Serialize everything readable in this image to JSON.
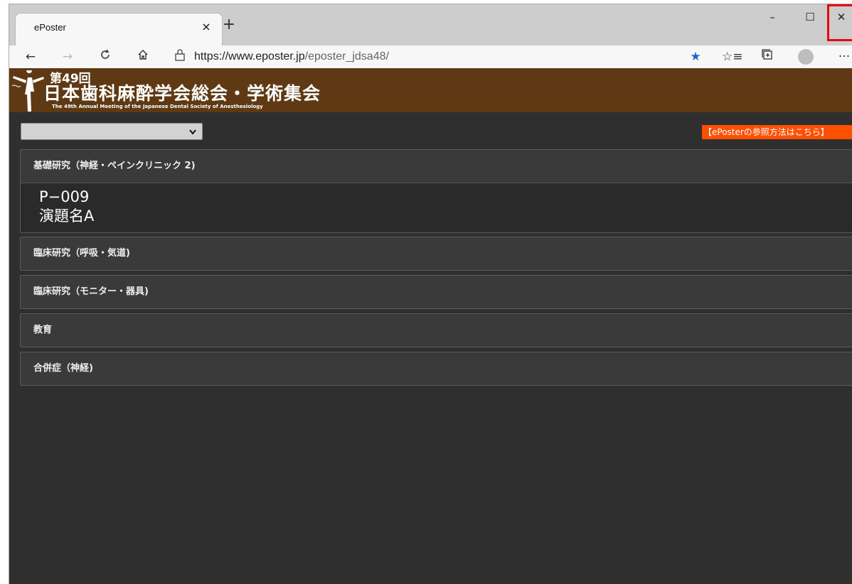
{
  "browser": {
    "tab_title": "ePoster",
    "tab_close_glyph": "×",
    "new_tab_glyph": "+",
    "url_host": "https://www.eposter.jp",
    "url_path": "/eposter_jdsa48/",
    "window_controls": {
      "minimize": "–",
      "maximize": "☐",
      "close": "✕"
    }
  },
  "banner": {
    "edition": "第49回",
    "title": "日本歯科麻酔学会総会・学術集会",
    "english": "The 49th Annual Meeting of the Japanese Dental Society of Anesthesiology"
  },
  "toolbar": {
    "select_value": "",
    "help_link": "【ePosterの参照方法はこちら】"
  },
  "sections": [
    {
      "title": "基礎研究（神経・ペインクリニック 2)",
      "expanded": true,
      "poster_number": "P−009",
      "poster_title": "演題名A"
    },
    {
      "title": "臨床研究（呼吸・気道)"
    },
    {
      "title": "臨床研究（モニター・器具)"
    },
    {
      "title": "教育"
    },
    {
      "title": "合併症（神経)"
    }
  ],
  "colors": {
    "banner": "#5e3913",
    "page_bg": "#2f2f2f",
    "accent_link": "#ff4f00",
    "close_highlight": "#e8000e",
    "star": "#1a62d6"
  },
  "icons": [
    "back-arrow-icon",
    "forward-arrow-icon",
    "reload-icon",
    "home-icon",
    "lock-icon",
    "favorite-star-icon",
    "favorites-list-icon",
    "collections-icon",
    "profile-icon",
    "more-icon",
    "chevron-down-icon"
  ]
}
